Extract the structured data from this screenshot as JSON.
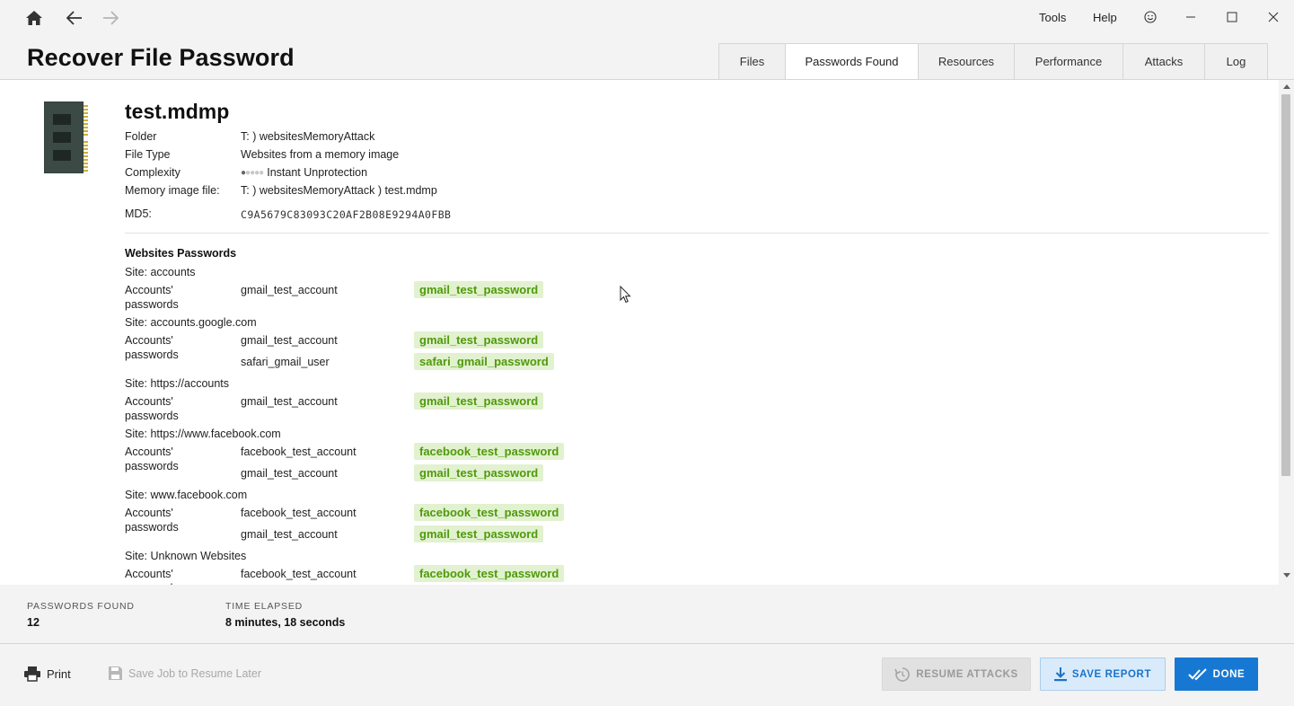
{
  "titlebar": {
    "menu": [
      "Tools",
      "Help"
    ],
    "icons": [
      "home-icon",
      "back-arrow-icon",
      "forward-arrow-icon",
      "feedback-smiley-icon",
      "minimize-icon",
      "maximize-icon",
      "close-icon"
    ]
  },
  "page": {
    "title": "Recover File Password"
  },
  "tabs": [
    {
      "label": "Files",
      "active": false
    },
    {
      "label": "Passwords Found",
      "active": true
    },
    {
      "label": "Resources",
      "active": false
    },
    {
      "label": "Performance",
      "active": false
    },
    {
      "label": "Attacks",
      "active": false
    },
    {
      "label": "Log",
      "active": false
    }
  ],
  "file": {
    "icon": "memory-module-icon",
    "name": "test.mdmp",
    "info": [
      {
        "label": "Folder",
        "value": "T: ) websitesMemoryAttack"
      },
      {
        "label": "File Type",
        "value": "Websites from a memory image"
      },
      {
        "label": "Complexity",
        "value": "Instant Unprotection",
        "level": 1,
        "max": 5
      },
      {
        "label": "Memory image file:",
        "value": "T: ) websitesMemoryAttack ) test.mdmp"
      },
      {
        "label": "MD5:",
        "value": "C9A5679C83093C20AF2B08E9294A0FBB"
      }
    ]
  },
  "passwords": {
    "section_title": "Websites Passwords",
    "accounts_label_1": "Accounts'",
    "accounts_label_2": "passwords",
    "sites": [
      {
        "site": "Site: accounts",
        "entries": [
          {
            "account": "gmail_test_account",
            "password": "gmail_test_password"
          }
        ]
      },
      {
        "site": "Site: accounts.google.com",
        "entries": [
          {
            "account": "gmail_test_account",
            "password": "gmail_test_password"
          },
          {
            "account": "safari_gmail_user",
            "password": "safari_gmail_password"
          }
        ]
      },
      {
        "site": "Site: https://accounts",
        "entries": [
          {
            "account": "gmail_test_account",
            "password": "gmail_test_password"
          }
        ]
      },
      {
        "site": "Site: https://www.facebook.com",
        "entries": [
          {
            "account": "facebook_test_account",
            "password": "facebook_test_password"
          },
          {
            "account": "gmail_test_account",
            "password": "gmail_test_password"
          }
        ]
      },
      {
        "site": "Site: www.facebook.com",
        "entries": [
          {
            "account": "facebook_test_account",
            "password": "facebook_test_password"
          },
          {
            "account": "gmail_test_account",
            "password": "gmail_test_password"
          }
        ]
      },
      {
        "site": "Site: Unknown Websites",
        "entries": [
          {
            "account": "facebook_test_account",
            "password": "facebook_test_password"
          }
        ]
      }
    ]
  },
  "stats": {
    "passwords_found_label": "PASSWORDS FOUND",
    "passwords_found_value": "12",
    "time_elapsed_label": "TIME ELAPSED",
    "time_elapsed_value": "8 minutes, 18 seconds"
  },
  "footer": {
    "print_label": "Print",
    "save_job_label": "Save Job to Resume Later",
    "resume_label": "RESUME ATTACKS",
    "save_report_label": "SAVE REPORT",
    "done_label": "DONE"
  },
  "colors": {
    "accent": "#1778d4",
    "password_text": "#4f9a0c",
    "password_bg": "#e2f1cf"
  }
}
